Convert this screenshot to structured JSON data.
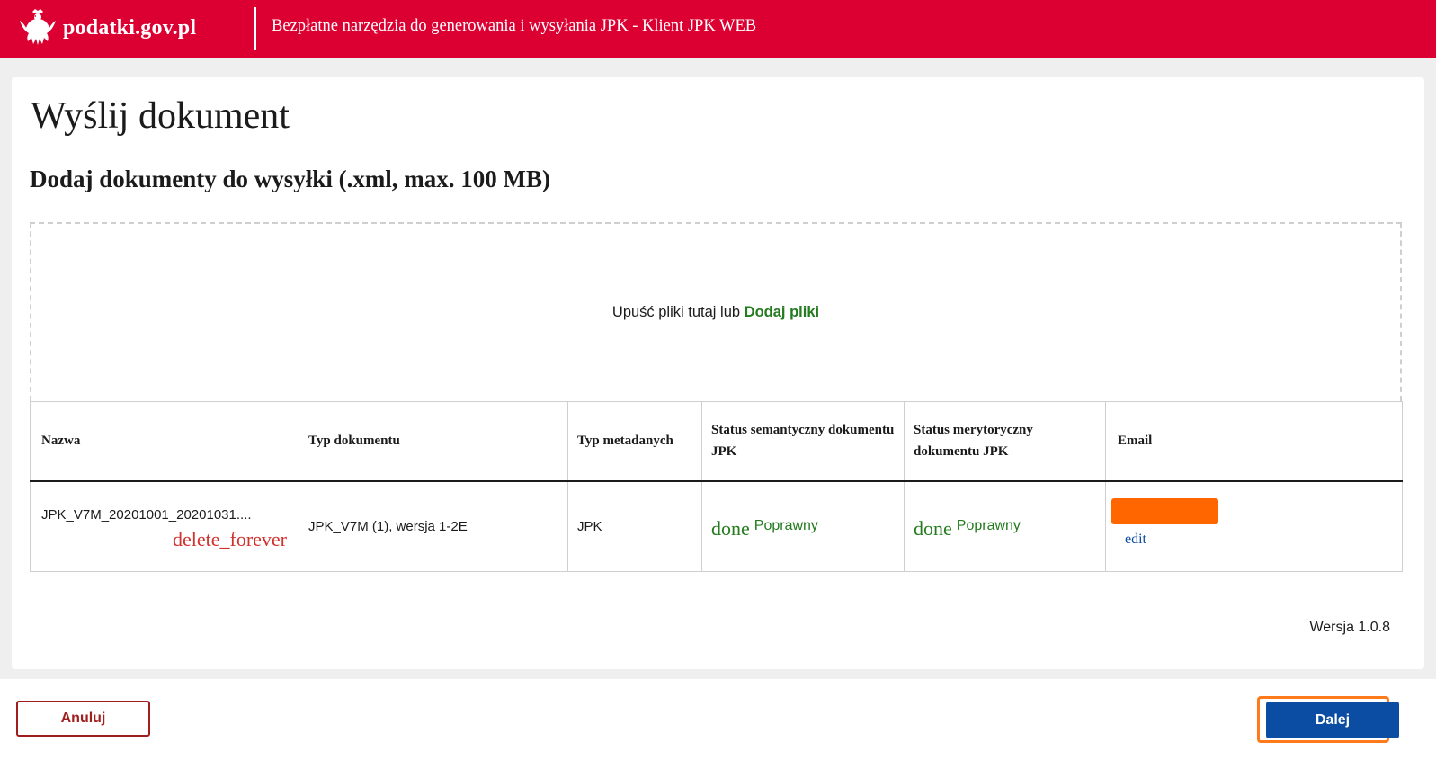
{
  "header": {
    "logo_text": "podatki.gov.pl",
    "title": "Bezpłatne narzędzia do generowania i wysyłania JPK - Klient JPK WEB"
  },
  "main": {
    "title": "Wyślij dokument",
    "subtitle": "Dodaj dokumenty do wysyłki (.xml, max. 100 MB)",
    "dropzone": {
      "text": "Upuść pliki tutaj lub",
      "link": "Dodaj pliki"
    },
    "table": {
      "headers": {
        "nazwa": "Nazwa",
        "typ_dokumentu": "Typ dokumentu",
        "typ_metadanych": "Typ metadanych",
        "status_semantyczny": "Status semantyczny dokumentu JPK",
        "status_merytoryczny": "Status merytoryczny dokumentu JPK",
        "email": "Email"
      },
      "rows": [
        {
          "nazwa": "JPK_V7M_20201001_20201031....",
          "delete": "delete_forever",
          "typ_dokumentu": "JPK_V7M (1), wersja 1-2E",
          "typ_metadanych": "JPK",
          "status_semantyczny": {
            "icon": "done",
            "label": "Poprawny"
          },
          "status_merytoryczny": {
            "icon": "done",
            "label": "Poprawny"
          },
          "email_edit": "edit"
        }
      ]
    },
    "version": "Wersja 1.0.8"
  },
  "footer": {
    "cancel": "Anuluj",
    "next": "Dalej"
  },
  "colors": {
    "brand_red": "#dc0032",
    "success_green": "#237b1e",
    "primary_blue": "#0b4da2",
    "redaction_orange": "#ff6600",
    "highlight_orange": "#ff7a1a"
  }
}
